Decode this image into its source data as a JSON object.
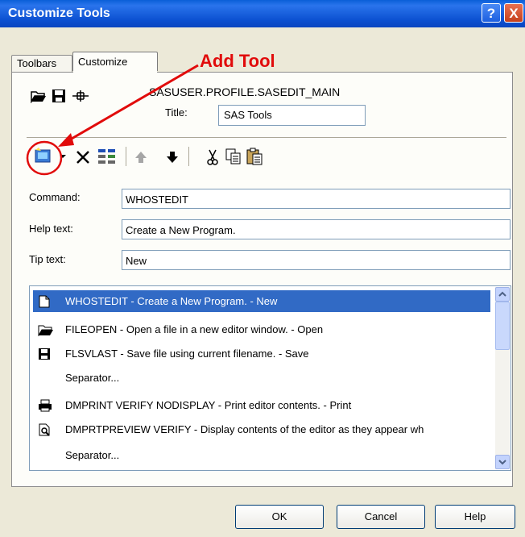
{
  "window": {
    "title": "Customize Tools",
    "help_glyph": "?",
    "close_glyph": "X"
  },
  "tabs": [
    {
      "label": "Toolbars"
    },
    {
      "label": "Customize"
    }
  ],
  "profile": {
    "name": "SASUSER.PROFILE.SASEDIT_MAIN",
    "title_label": "Title:",
    "title_value": "SAS Tools"
  },
  "toolbar_icons": [
    "open-icon",
    "save-icon",
    "tool-icon",
    "add-tool-icon",
    "dropdown-arrow-icon",
    "delete-icon",
    "properties-icon",
    "move-up-icon",
    "move-down-icon",
    "cut-icon",
    "copy-icon",
    "paste-icon"
  ],
  "fields": {
    "command": {
      "label": "Command:",
      "value": "WHOSTEDIT"
    },
    "help_text": {
      "label": "Help text:",
      "value": "Create a New Program."
    },
    "tip_text": {
      "label": "Tip text:",
      "value": "New"
    }
  },
  "list": [
    {
      "icon": "new-file-icon",
      "text": "WHOSTEDIT - Create a New Program. - New",
      "selected": true
    },
    {
      "icon": "open-folder-icon",
      "text": "FILEOPEN - Open a file in a new editor window. - Open",
      "selected": false
    },
    {
      "icon": "save-icon",
      "text": "FLSVLAST - Save file using current filename. - Save",
      "selected": false
    },
    {
      "icon": "",
      "text": "Separator...",
      "selected": false
    },
    {
      "icon": "printer-icon",
      "text": "DMPRINT VERIFY NODISPLAY - Print editor contents. - Print",
      "selected": false
    },
    {
      "icon": "print-preview-icon",
      "text": "DMPRTPREVIEW VERIFY - Display contents of the editor as they appear wh",
      "selected": false
    },
    {
      "icon": "",
      "text": "Separator...",
      "selected": false
    }
  ],
  "buttons": {
    "ok": "OK",
    "cancel": "Cancel",
    "help": "Help"
  },
  "annotation": {
    "label": "Add Tool",
    "color": "#e10b0b"
  }
}
